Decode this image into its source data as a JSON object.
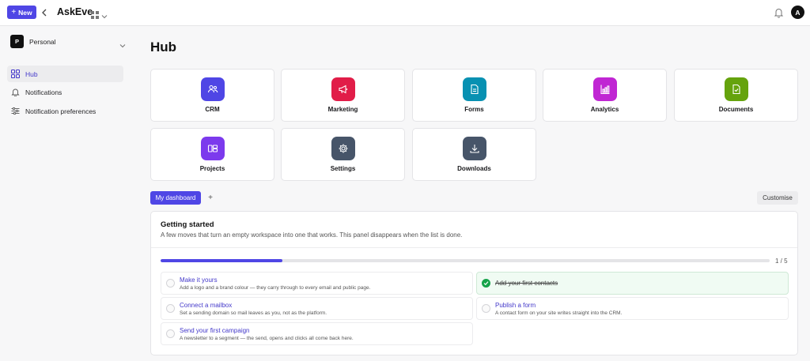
{
  "topbar": {
    "new_label": "New",
    "app_title": "AskEve",
    "avatar_initial": "A"
  },
  "sidebar": {
    "workspace_initial": "P",
    "workspace_name": "Personal",
    "items": [
      {
        "label": "Hub",
        "icon": "grid-icon",
        "active": true
      },
      {
        "label": "Notifications",
        "icon": "bell-icon",
        "active": false
      },
      {
        "label": "Notification preferences",
        "icon": "sliders-icon",
        "active": false
      }
    ]
  },
  "main": {
    "title": "Hub",
    "tiles": [
      {
        "label": "CRM",
        "icon": "users-icon",
        "color": "#4f46e5"
      },
      {
        "label": "Marketing",
        "icon": "megaphone-icon",
        "color": "#e11d48"
      },
      {
        "label": "Forms",
        "icon": "form-icon",
        "color": "#0891b2"
      },
      {
        "label": "Analytics",
        "icon": "bar-chart-icon",
        "color": "#c026d3"
      },
      {
        "label": "Documents",
        "icon": "document-icon",
        "color": "#65a30d"
      },
      {
        "label": "Projects",
        "icon": "projects-icon",
        "color": "#7c3aed"
      },
      {
        "label": "Settings",
        "icon": "gear-icon",
        "color": "#475569"
      },
      {
        "label": "Downloads",
        "icon": "download-icon",
        "color": "#475569"
      }
    ],
    "tabs": [
      {
        "label": "My dashboard",
        "active": true
      }
    ],
    "tab_add": "+",
    "customise_label": "Customise"
  },
  "getting_started": {
    "title": "Getting started",
    "subtitle": "A few moves that turn an empty workspace into one that works. This panel disappears when the list is done.",
    "progress_fraction": 0.2,
    "progress_text": "1 / 5",
    "tasks": [
      {
        "title": "Make it yours",
        "desc": "Add a logo and a brand colour — they carry through to every email and public page.",
        "done": false
      },
      {
        "title": "Add your first contacts",
        "desc": "",
        "done": true
      },
      {
        "title": "Connect a mailbox",
        "desc": "Set a sending domain so mail leaves as you, not as the platform.",
        "done": false
      },
      {
        "title": "Publish a form",
        "desc": "A contact form on your site writes straight into the CRM.",
        "done": false
      },
      {
        "title": "Send your first campaign",
        "desc": "A newsletter to a segment — the send, opens and clicks all come back here.",
        "done": false
      }
    ]
  }
}
